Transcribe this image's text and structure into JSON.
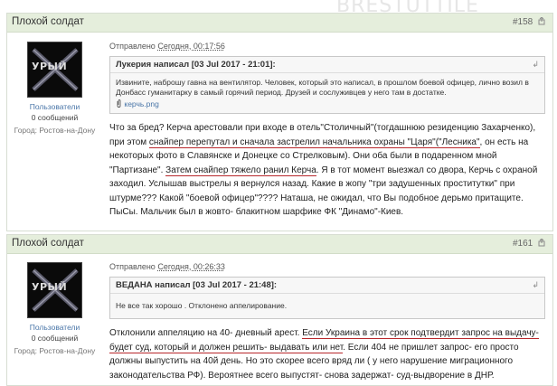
{
  "watermark": "BRESTUTTILE",
  "posts": [
    {
      "author": "Плохой солдат",
      "number": "#158",
      "role": "Пользователи",
      "count": "0 сообщений",
      "city": "Город: Ростов-на-Дону",
      "avatar_text": "УРЫЙ",
      "sent_prefix": "Отправлено",
      "sent_date": "Сегодня, 00:17:56",
      "quote_head": "Лукерия написал [03 Jul 2017 - 21:01]:",
      "quote_text": "Извините, наброшу гавна на вентилятор. Человек, который это написал, в прошлом боевой офицер, лично возил в Донбасс гуманитарку в самый горячий период. Друзей и сослуживцев у него там в достатке.",
      "attachment": "керчь.png",
      "body": [
        {
          "t": "Что за бред? Керча арестовали при входе в отель\"Столичный\"(тогдашнюю резиденцию Захарченко), при этом ",
          "u": false
        },
        {
          "t": "снайпер перепутал и сначала застрелил начальника охраны \"Царя\"(\"Лесника\"",
          "u": true
        },
        {
          "t": ", он есть на некоторых фото в Славянске и Донецке со Стрелковым). Они оба были в подаренном мной \"Партизане\". ",
          "u": false
        },
        {
          "t": "Затем снайпер тяжело ранил Керча",
          "u": true
        },
        {
          "t": ". Я в тот момент выезжал со двора, Керчь с охраной заходил. Услышав выстрелы я вернулся назад. Какие в жопу \"три задушенных проститутки\" при штурме??? Какой \"боевой офицер\"???? Наташа, не ожидал, что Вы подобное дерьмо притащите.",
          "u": false
        }
      ],
      "ps": "ПыСы. Мальчик был в жовто- блакитном шарфике ФК \"Динамо\"-Киев."
    },
    {
      "author": "Плохой солдат",
      "number": "#161",
      "role": "Пользователи",
      "count": "0 сообщений",
      "city": "Город: Ростов-на-Дону",
      "avatar_text": "УРЫЙ",
      "sent_prefix": "Отправлено",
      "sent_date": "Сегодня, 00:26:33",
      "quote_head": "ВЕДАНА написал [03 Jul 2017 - 21:48]:",
      "quote_text": "Не все так хорошо . Отклонено аппелирование.",
      "body": [
        {
          "t": "Отклонили аппеляцию на 40- дневный арест. ",
          "u": false
        },
        {
          "t": "Если Украина в этот срок подтвердит запрос на выдачу- будет суд, который и должен решить- выдавать или нет",
          "u": true
        },
        {
          "t": ". Если 404 не пришлет запрос- его просто должны выпустить на 40й день. Но это скорее всего вряд ли ( у него нарушение миграционного законодательства РФ). Вероятнее всего выпустят- снова задержат- суд-выдворение в ДНР.",
          "u": false
        }
      ]
    }
  ]
}
